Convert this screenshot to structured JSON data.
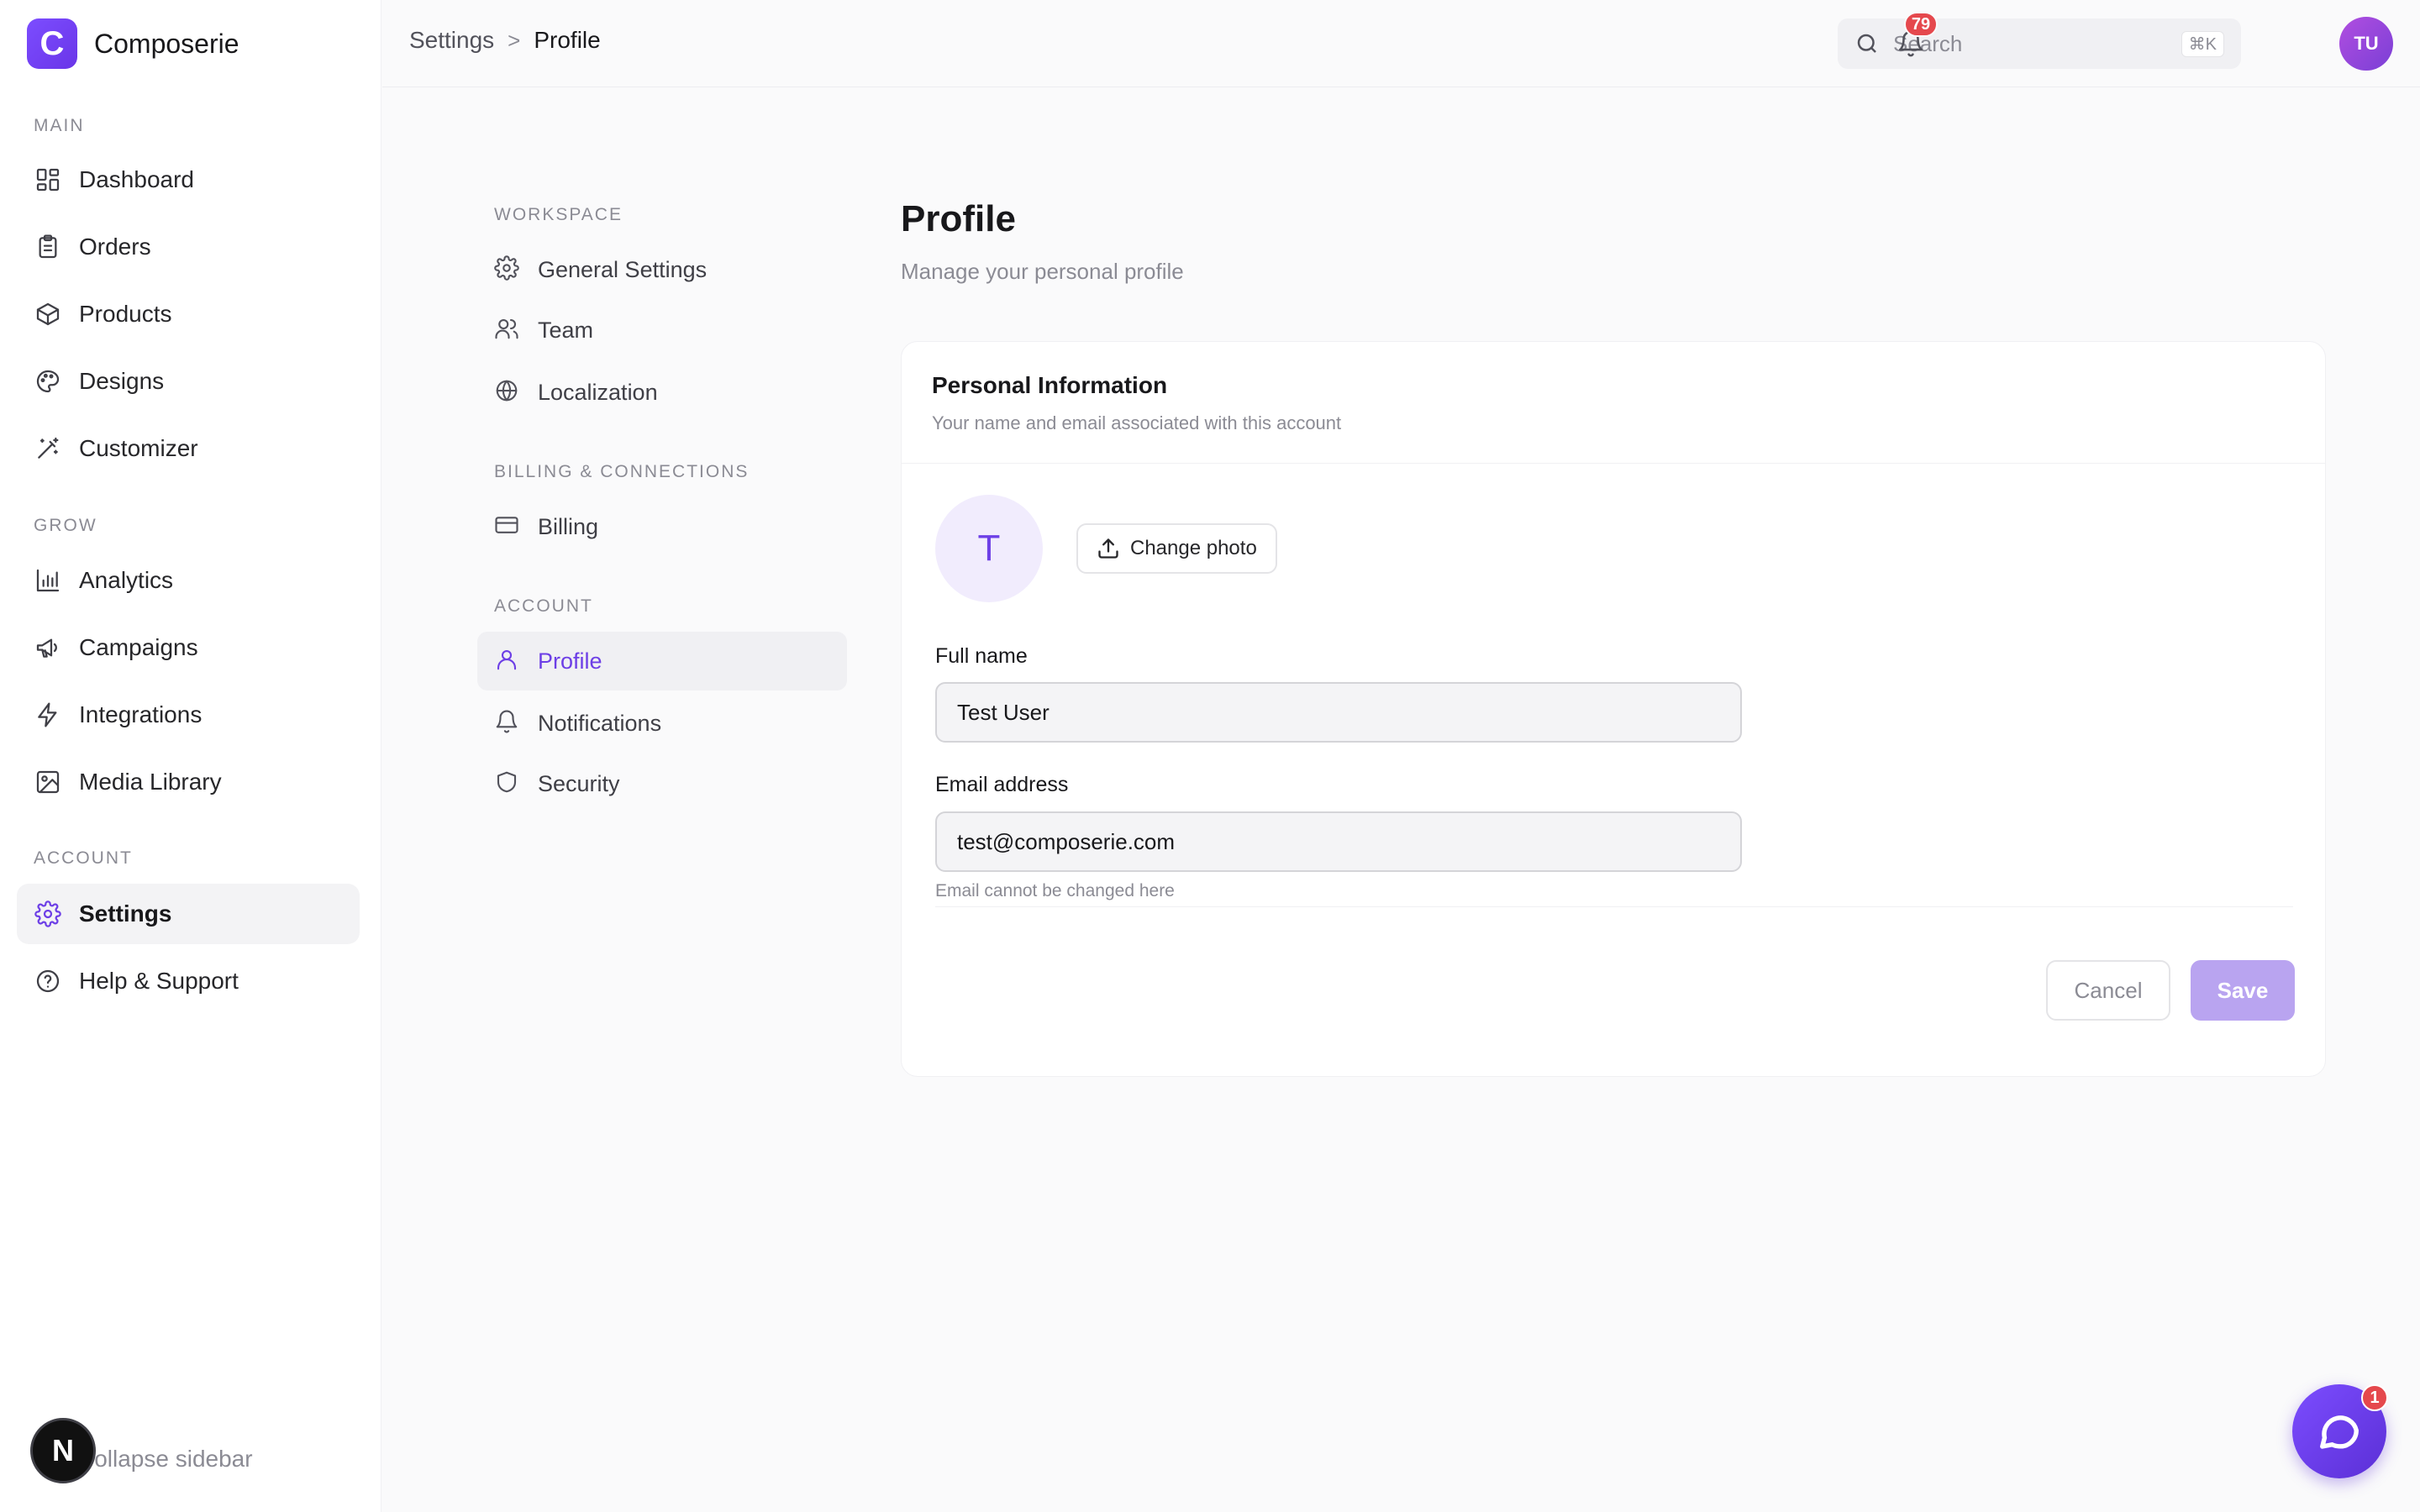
{
  "brand": {
    "logo_letter": "C",
    "name": "Composerie",
    "accent": "#6d3fe6"
  },
  "sidebar": {
    "sections": [
      {
        "label": "MAIN"
      },
      {
        "label": "GROW"
      },
      {
        "label": "ACCOUNT"
      }
    ],
    "items": [
      {
        "label": "Dashboard",
        "icon": "dashboard-icon"
      },
      {
        "label": "Orders",
        "icon": "clipboard-icon"
      },
      {
        "label": "Products",
        "icon": "box-icon"
      },
      {
        "label": "Designs",
        "icon": "palette-icon"
      },
      {
        "label": "Customizer",
        "icon": "wand-icon"
      },
      {
        "label": "Analytics",
        "icon": "bar-chart-icon"
      },
      {
        "label": "Campaigns",
        "icon": "megaphone-icon"
      },
      {
        "label": "Integrations",
        "icon": "lightning-icon"
      },
      {
        "label": "Media Library",
        "icon": "image-icon"
      },
      {
        "label": "Settings",
        "icon": "gear-icon",
        "active": true
      },
      {
        "label": "Help & Support",
        "icon": "help-circle-icon"
      }
    ],
    "collapse_label": "Collapse sidebar",
    "dev_badge": "N"
  },
  "topbar": {
    "breadcrumb": {
      "parent": "Settings",
      "separator": ">",
      "current": "Profile"
    },
    "search": {
      "placeholder": "Search",
      "shortcut": "⌘K"
    },
    "notifications_count": "79",
    "user_initials": "TU"
  },
  "settings_nav": {
    "sections": [
      {
        "label": "WORKSPACE"
      },
      {
        "label": "BILLING & CONNECTIONS"
      },
      {
        "label": "ACCOUNT"
      }
    ],
    "items": [
      {
        "label": "General Settings",
        "icon": "gear-icon"
      },
      {
        "label": "Team",
        "icon": "users-icon"
      },
      {
        "label": "Localization",
        "icon": "globe-icon"
      },
      {
        "label": "Billing",
        "icon": "credit-card-icon"
      },
      {
        "label": "Profile",
        "icon": "user-icon",
        "active": true
      },
      {
        "label": "Notifications",
        "icon": "bell-icon"
      },
      {
        "label": "Security",
        "icon": "shield-icon"
      }
    ]
  },
  "main": {
    "title": "Profile",
    "subtitle": "Manage your personal profile",
    "card": {
      "title": "Personal Information",
      "description": "Your name and email associated with this account",
      "avatar_initial": "T",
      "change_photo_label": "Change photo",
      "full_name_label": "Full name",
      "full_name_value": "Test User",
      "email_label": "Email address",
      "email_value": "test@composerie.com",
      "email_help": "Email cannot be changed here",
      "cancel_label": "Cancel",
      "save_label": "Save"
    }
  },
  "chat": {
    "unread_count": "1"
  }
}
